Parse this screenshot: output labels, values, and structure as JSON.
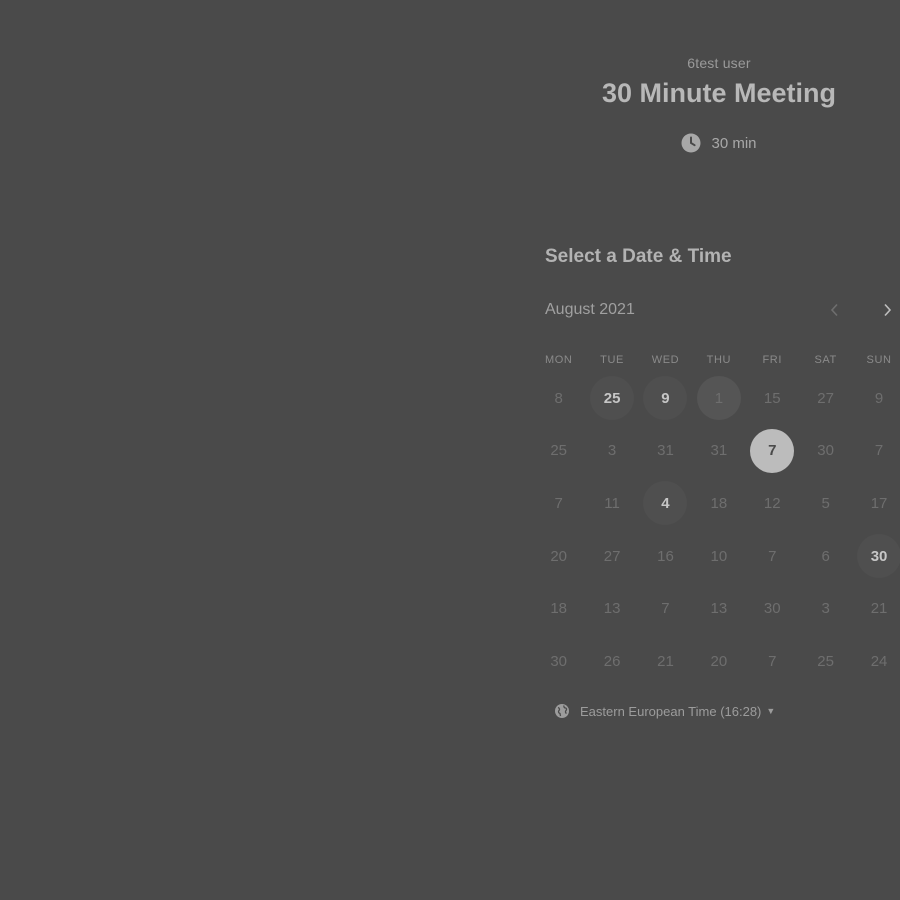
{
  "header": {
    "organizer": "6test user",
    "event_title": "30 Minute Meeting",
    "duration": "30 min",
    "duration_icon": "clock-icon"
  },
  "scheduler": {
    "section_title": "Select a Date & Time",
    "month_label": "August 2021",
    "prev_icon": "chevron-left-icon",
    "next_icon": "chevron-right-icon",
    "weekdays": [
      "MON",
      "TUE",
      "WED",
      "THU",
      "FRI",
      "SAT",
      "SUN"
    ],
    "weeks": [
      [
        {
          "label": "8",
          "state": "disabled"
        },
        {
          "label": "25",
          "state": "available"
        },
        {
          "label": "9",
          "state": "available"
        },
        {
          "label": "1",
          "state": "today"
        },
        {
          "label": "15",
          "state": "disabled"
        },
        {
          "label": "27",
          "state": "disabled"
        },
        {
          "label": "9",
          "state": "disabled"
        }
      ],
      [
        {
          "label": "25",
          "state": "disabled"
        },
        {
          "label": "3",
          "state": "disabled"
        },
        {
          "label": "31",
          "state": "disabled"
        },
        {
          "label": "31",
          "state": "disabled"
        },
        {
          "label": "7",
          "state": "selected"
        },
        {
          "label": "30",
          "state": "disabled"
        },
        {
          "label": "7",
          "state": "disabled"
        }
      ],
      [
        {
          "label": "7",
          "state": "disabled"
        },
        {
          "label": "11",
          "state": "disabled"
        },
        {
          "label": "4",
          "state": "available"
        },
        {
          "label": "18",
          "state": "disabled"
        },
        {
          "label": "12",
          "state": "disabled"
        },
        {
          "label": "5",
          "state": "disabled"
        },
        {
          "label": "17",
          "state": "disabled"
        }
      ],
      [
        {
          "label": "20",
          "state": "disabled"
        },
        {
          "label": "27",
          "state": "disabled"
        },
        {
          "label": "16",
          "state": "disabled"
        },
        {
          "label": "10",
          "state": "disabled"
        },
        {
          "label": "7",
          "state": "disabled"
        },
        {
          "label": "6",
          "state": "disabled"
        },
        {
          "label": "30",
          "state": "available"
        }
      ],
      [
        {
          "label": "18",
          "state": "disabled"
        },
        {
          "label": "13",
          "state": "disabled"
        },
        {
          "label": "7",
          "state": "disabled"
        },
        {
          "label": "13",
          "state": "disabled"
        },
        {
          "label": "30",
          "state": "disabled"
        },
        {
          "label": "3",
          "state": "disabled"
        },
        {
          "label": "21",
          "state": "disabled"
        }
      ],
      [
        {
          "label": "30",
          "state": "disabled"
        },
        {
          "label": "26",
          "state": "disabled"
        },
        {
          "label": "21",
          "state": "disabled"
        },
        {
          "label": "20",
          "state": "disabled"
        },
        {
          "label": "7",
          "state": "disabled"
        },
        {
          "label": "25",
          "state": "disabled"
        },
        {
          "label": "24",
          "state": "disabled"
        }
      ]
    ],
    "timezone": {
      "label": "Eastern European Time (16:28)",
      "icon": "globe-icon",
      "caret_icon": "caret-down-icon"
    }
  },
  "colors": {
    "background": "#4a4a4a",
    "selected_day": "#bcbcbc"
  }
}
